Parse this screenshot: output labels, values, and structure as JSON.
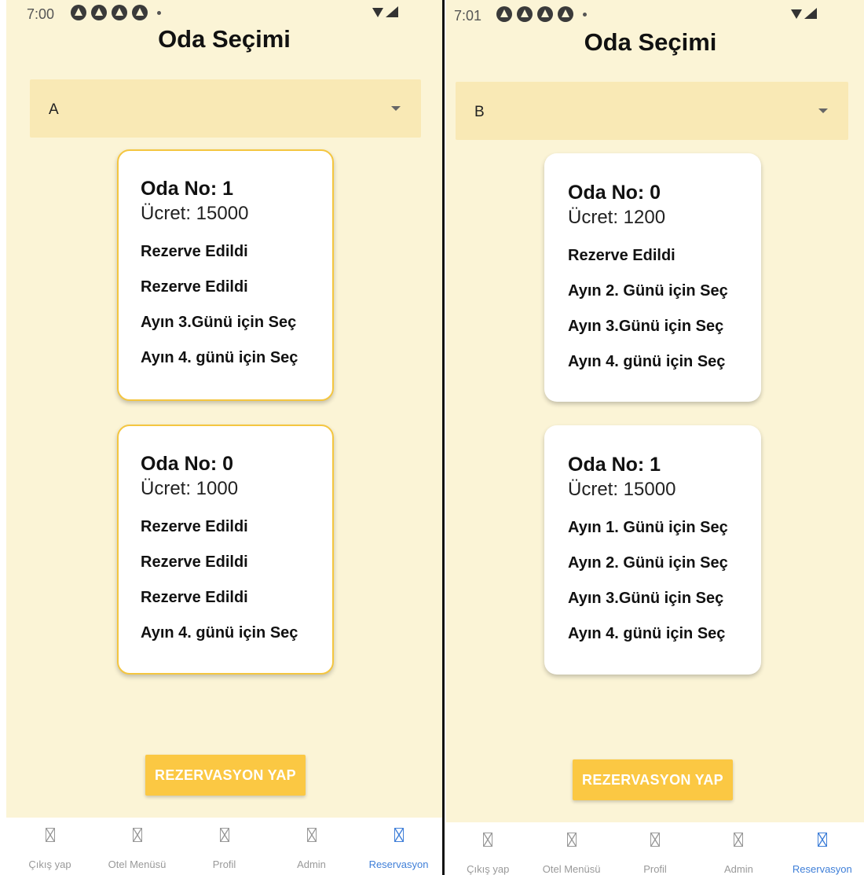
{
  "left_screen": {
    "status_time": "7:00",
    "title": "Oda Seçimi",
    "dropdown_value": "A",
    "cards": [
      {
        "title": "Oda No: 1",
        "price": "Ücret: 15000",
        "days": [
          "Rezerve Edildi",
          "Rezerve Edildi",
          "Ayın 3.Günü için Seç",
          "Ayın 4. günü için Seç"
        ]
      },
      {
        "title": "Oda No: 0",
        "price": "Ücret: 1000",
        "days": [
          "Rezerve Edildi",
          "Rezerve Edildi",
          "Rezerve Edildi",
          "Ayın 4. günü için Seç"
        ]
      }
    ],
    "reserve_button": "REZERVASYON YAP",
    "nav": [
      "Çıkış yap",
      "Otel Menüsü",
      "Profil",
      "Admin",
      "Reservasyon"
    ]
  },
  "right_screen": {
    "status_time": "7:01",
    "title": "Oda Seçimi",
    "dropdown_value": "B",
    "cards": [
      {
        "title": "Oda No: 0",
        "price": "Ücret: 1200",
        "days": [
          "Rezerve Edildi",
          "Ayın 2. Günü için Seç",
          "Ayın 3.Günü için Seç",
          "Ayın 4. günü için Seç"
        ]
      },
      {
        "title": "Oda No: 1",
        "price": "Ücret: 15000",
        "days": [
          "Ayın 1. Günü için Seç",
          "Ayın 2. Günü için Seç",
          "Ayın 3.Günü için Seç",
          "Ayın 4. günü için Seç"
        ]
      }
    ],
    "reserve_button": "REZERVASYON YAP",
    "nav": [
      "Çıkış yap",
      "Otel Menüsü",
      "Profil",
      "Admin",
      "Reservasyon"
    ]
  },
  "colors": {
    "background": "#fbf4d6",
    "dropdown": "#f9e9b5",
    "accent": "#fbc843",
    "selected_border": "#f4c640",
    "active_nav": "#3f7fd8"
  },
  "icons": {
    "status": "android-notification-icon",
    "dropdown": "dropdown-arrow-icon",
    "nav": "missing-image-placeholder-icon"
  }
}
